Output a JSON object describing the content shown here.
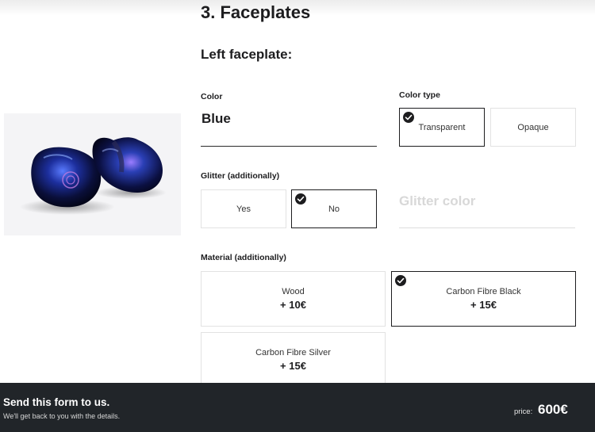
{
  "section": {
    "title": "3. Faceplates"
  },
  "left_faceplate": {
    "title": "Left faceplate:",
    "color": {
      "label": "Color",
      "value": "Blue"
    },
    "color_type": {
      "label": "Color type",
      "options": [
        {
          "label": "Transparent",
          "selected": true
        },
        {
          "label": "Opaque",
          "selected": false
        }
      ]
    },
    "glitter": {
      "label": "Glitter (additionally)",
      "options": [
        {
          "label": "Yes",
          "selected": false
        },
        {
          "label": "No",
          "selected": true
        }
      ],
      "color_placeholder": "Glitter color"
    },
    "material": {
      "label": "Material (additionally)",
      "options": [
        {
          "label": "Wood",
          "price": "+ 10€",
          "selected": false
        },
        {
          "label": "Carbon Fibre Black",
          "price": "+ 15€",
          "selected": true
        },
        {
          "label": "Carbon Fibre Silver",
          "price": "+ 15€",
          "selected": false
        }
      ]
    }
  },
  "footer": {
    "title": "Send this form to us.",
    "subtitle": "We'll get back to you with the details.",
    "price_label": "price:",
    "price_value": "600€"
  },
  "colors": {
    "footer_bg": "#212529",
    "text_dark": "#1d1d1f",
    "selected_border": "#1d1d1f",
    "placeholder_text": "#d8d8d8"
  }
}
